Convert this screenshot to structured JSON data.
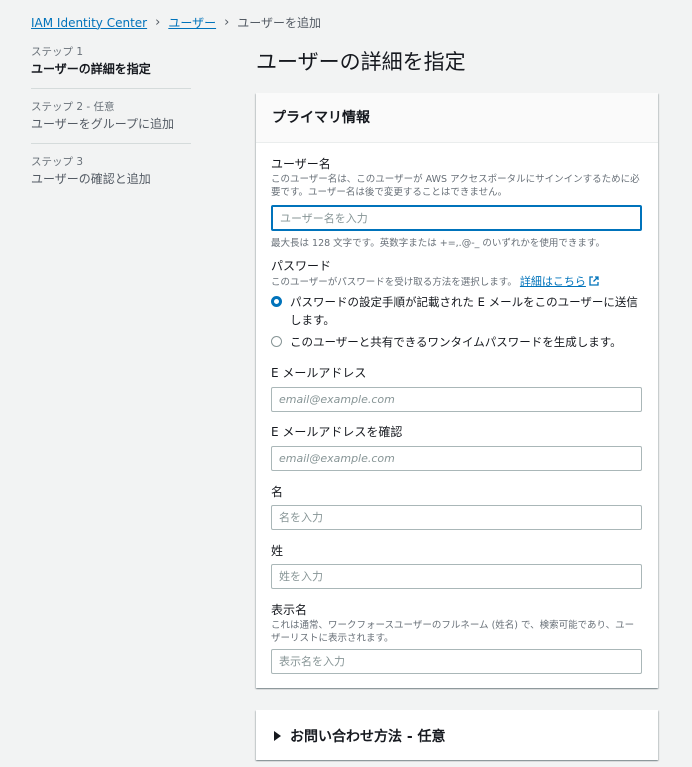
{
  "breadcrumb": {
    "items": [
      "IAM Identity Center",
      "ユーザー"
    ],
    "current": "ユーザーを追加"
  },
  "steps": [
    {
      "num": "ステップ 1",
      "title": "ユーザーの詳細を指定"
    },
    {
      "num": "ステップ 2 - 任意",
      "title": "ユーザーをグループに追加"
    },
    {
      "num": "ステップ 3",
      "title": "ユーザーの確認と追加"
    }
  ],
  "page_title": "ユーザーの詳細を指定",
  "primary": {
    "header": "プライマリ情報",
    "username": {
      "label": "ユーザー名",
      "desc": "このユーザー名は、このユーザーが AWS アクセスポータルにサインインするために必要です。ユーザー名は後で変更することはできません。",
      "placeholder": "ユーザー名を入力",
      "constraint": "最大長は 128 文字です。英数字または +=,.@-_ のいずれかを使用できます。"
    },
    "password": {
      "label": "パスワード",
      "desc": "このユーザーがパスワードを受け取る方法を選択します。",
      "link": "詳細はこちら",
      "options": [
        "パスワードの設定手順が記載された E メールをこのユーザーに送信します。",
        "このユーザーと共有できるワンタイムパスワードを生成します。"
      ]
    },
    "email": {
      "label": "E メールアドレス",
      "placeholder": "email@example.com"
    },
    "email_confirm": {
      "label": "E メールアドレスを確認",
      "placeholder": "email@example.com"
    },
    "first_name": {
      "label": "名",
      "placeholder": "名を入力"
    },
    "last_name": {
      "label": "姓",
      "placeholder": "姓を入力"
    },
    "display_name": {
      "label": "表示名",
      "desc": "これは通常、ワークフォースユーザーのフルネーム (姓名) で、検索可能であり、ユーザーリストに表示されます。",
      "placeholder": "表示名を入力"
    }
  },
  "contact": {
    "header": "お問い合わせ方法 - 任意"
  },
  "colors": {
    "link": "#0073bb",
    "focus": "#0073bb",
    "background": "#f2f3f3"
  }
}
